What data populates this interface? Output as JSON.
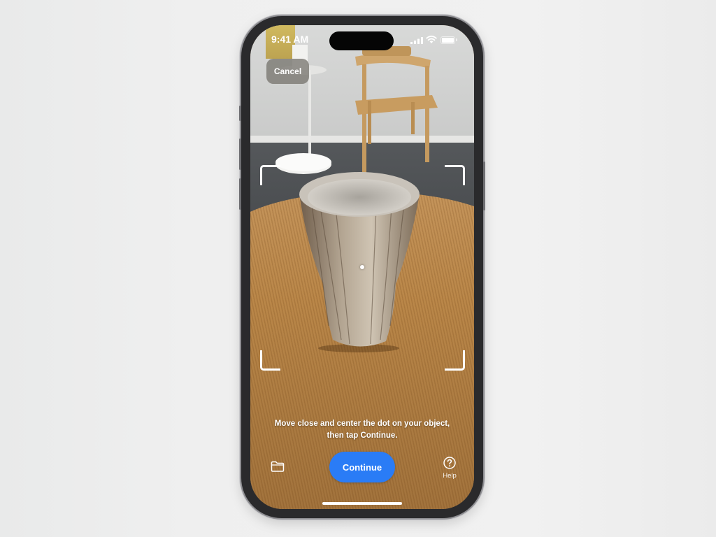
{
  "status_bar": {
    "time": "9:41 AM",
    "icons": [
      "cellular-signal-icon",
      "wifi-icon",
      "battery-icon"
    ]
  },
  "camera": {
    "cancel_label": "Cancel",
    "instruction_line1": "Move close and center the dot on your object,",
    "instruction_line2": "then tap Continue.",
    "continue_label": "Continue",
    "help_label": "Help",
    "help_icon": "question-mark-circle-icon",
    "files_icon": "folder-icon"
  },
  "colors": {
    "continue_button": "#2a7cf6",
    "cancel_button_bg": "#78766f"
  }
}
